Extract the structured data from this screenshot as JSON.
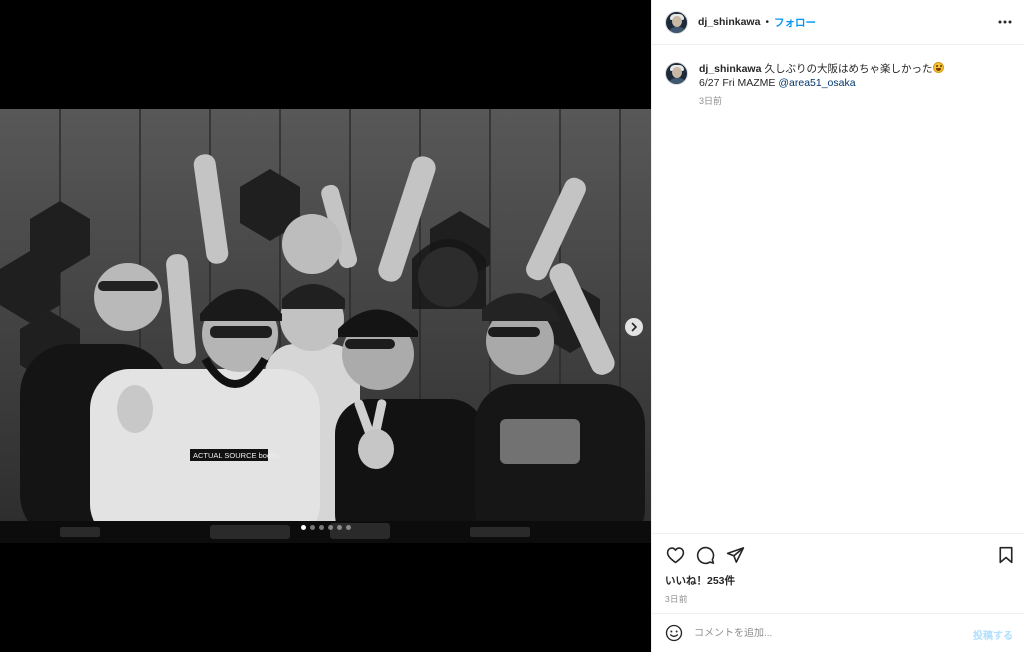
{
  "post": {
    "username": "dj_shinkawa",
    "separator": "•",
    "follow_label": "フォロー",
    "more_icon": "more-horizontal-icon"
  },
  "caption": {
    "username": "dj_shinkawa",
    "line1": "久しぶりの大阪はめちゃ楽しかった",
    "emoji": "grinning-emoji",
    "line2_prefix": "6/27 Fri MAZME ",
    "mention": "@area51_osaka",
    "time": "3日前"
  },
  "media": {
    "photo_description": "black-and-white group photo",
    "print_text": "ACTUAL SOURCE books",
    "carousel_dots": 6,
    "active_dot": 0,
    "next_icon": "chevron-right-icon"
  },
  "actions": {
    "like_icon": "heart-icon",
    "comment_icon": "comment-icon",
    "share_icon": "send-icon",
    "save_icon": "bookmark-icon",
    "likes_text": "いいね！253件",
    "time": "3日前"
  },
  "comment": {
    "placeholder": "コメントを追加...",
    "post_label": "投稿する",
    "emoji_icon": "smiley-icon"
  },
  "colors": {
    "accent": "#0095f6",
    "mention": "#00376b",
    "muted": "#8e8e8e",
    "post_disabled": "#b2dffc"
  }
}
